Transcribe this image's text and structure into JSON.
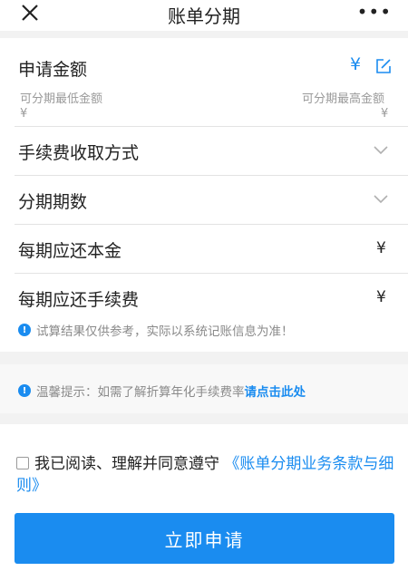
{
  "header": {
    "title": "账单分期",
    "more": "•••"
  },
  "amount": {
    "label": "申请金额",
    "currency": "¥",
    "min_label": "可分期最低金额",
    "max_label": "可分期最高金额",
    "min_value": "¥",
    "max_value": "¥"
  },
  "fee_method": {
    "label": "手续费收取方式"
  },
  "periods": {
    "label": "分期期数"
  },
  "principal": {
    "label": "每期应还本金",
    "value": "¥"
  },
  "fee": {
    "label": "每期应还手续费",
    "value": "¥"
  },
  "notice": {
    "text": "试算结果仅供参考，实际以系统记账信息为准！"
  },
  "tip": {
    "text": "温馨提示：如需了解折算年化手续费率 ",
    "link": "请点击此处"
  },
  "agreement": {
    "text": "我已阅读、理解并同意遵守 ",
    "link": "《账单分期业务条款与细则》"
  },
  "submit": {
    "label": "立即申请"
  },
  "colors": {
    "accent": "#1a8cf0",
    "background": "#f2f2f2"
  },
  "icons": [
    "close-icon",
    "more-icon",
    "edit-icon",
    "chevron-down-icon",
    "info-icon",
    "checkbox-icon"
  ]
}
